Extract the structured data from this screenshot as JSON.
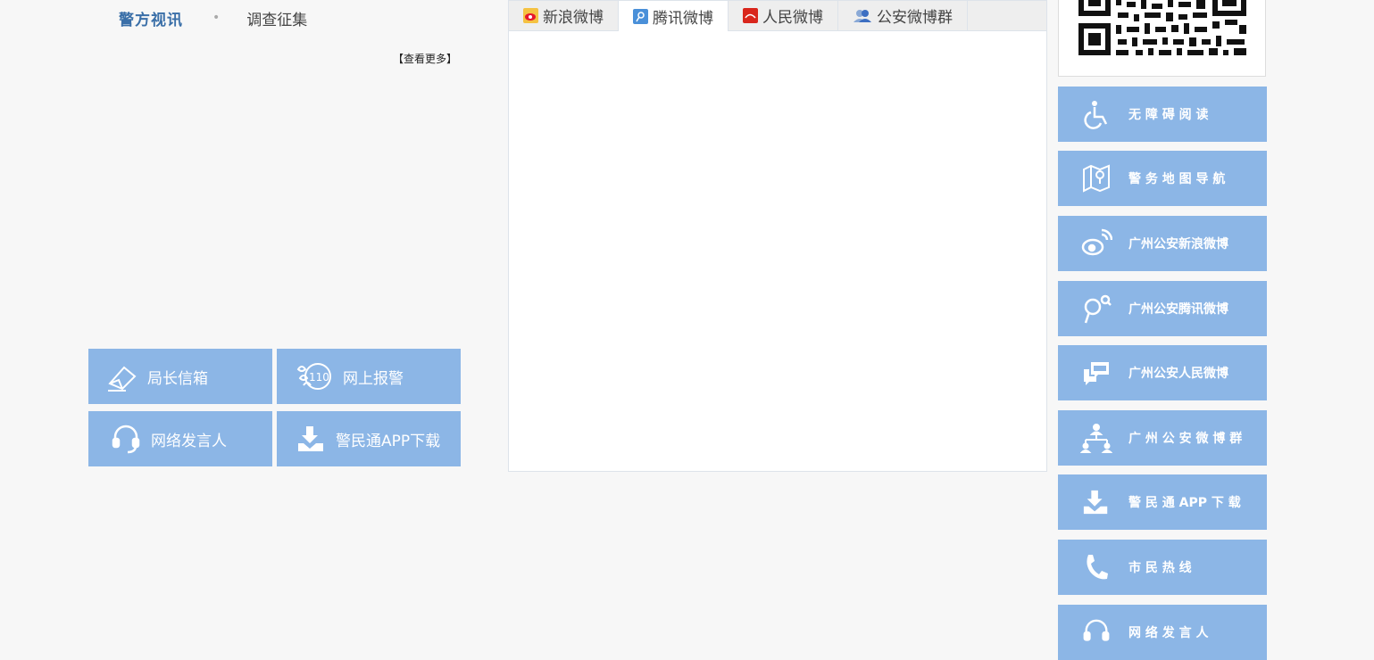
{
  "left": {
    "tabs": [
      {
        "label": "警方视讯"
      },
      {
        "label": "调查征集"
      }
    ],
    "more_label": "【查看更多】",
    "quick_buttons": [
      {
        "label": "局长信箱",
        "icon": "mail-envelope-icon"
      },
      {
        "label": "网上报警",
        "icon": "police-110-icon"
      },
      {
        "label": "网络发言人",
        "icon": "headset-icon"
      },
      {
        "label": "警民通APP下载",
        "icon": "download-icon"
      }
    ]
  },
  "weibo": {
    "tabs": [
      {
        "label": "新浪微博",
        "icon": "sina-weibo-icon"
      },
      {
        "label": "腾讯微博",
        "icon": "tencent-weibo-icon",
        "active": true
      },
      {
        "label": "人民微博",
        "icon": "people-weibo-icon"
      },
      {
        "label": "公安微博群",
        "icon": "group-icon"
      }
    ]
  },
  "right": {
    "buttons": [
      {
        "label": "无 障 碍 阅 读",
        "icon": "wheelchair-icon"
      },
      {
        "label": "警 务 地 图 导 航",
        "icon": "map-navigation-icon"
      },
      {
        "label": "广州公安新浪微博",
        "icon": "sina-weibo-icon"
      },
      {
        "label": "广州公安腾讯微博",
        "icon": "tencent-weibo-icon"
      },
      {
        "label": "广州公安人民微博",
        "icon": "chat-bubbles-icon"
      },
      {
        "label": "广 州 公 安 微 博 群",
        "icon": "org-chart-icon"
      },
      {
        "label": "警 民 通 APP 下 载",
        "icon": "download-icon"
      },
      {
        "label": "市 民 热 线",
        "icon": "phone-icon"
      },
      {
        "label": "网 络 发 言 人",
        "icon": "headset-icon"
      }
    ]
  },
  "colors": {
    "button_blue": "#8cb6e6",
    "active_tab_text": "#3a6fa8",
    "page_bg": "#f7f7f7"
  }
}
